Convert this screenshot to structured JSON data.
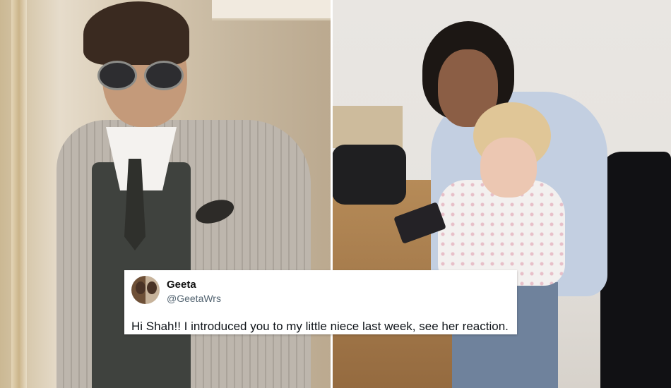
{
  "tweet": {
    "name": "Geeta",
    "handle": "@GeetaWrs",
    "text": "Hi Shah!! I introduced you to my little niece last week, see her reaction."
  },
  "photos": {
    "left": "man-in-checked-suit-photo",
    "right": "woman-and-child-with-tablet-photo"
  },
  "colors": {
    "card_bg": "#ffffff",
    "handle": "#536471",
    "text": "#0f1419"
  }
}
